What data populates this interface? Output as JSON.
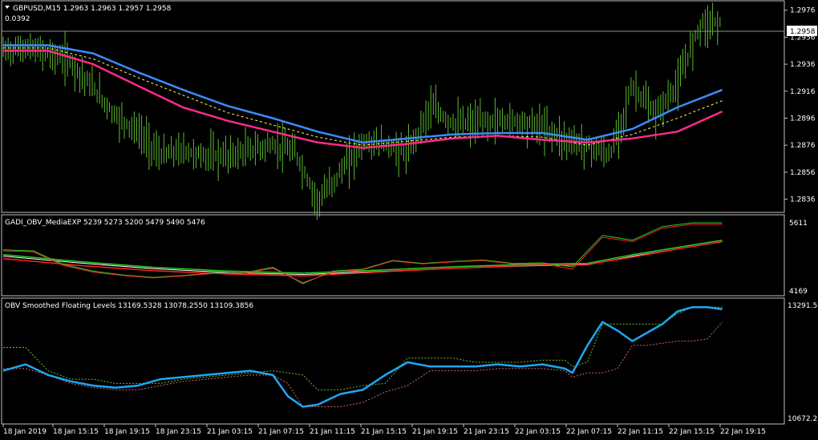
{
  "colors": {
    "background": "#000000",
    "foreground": "#ffffff",
    "grid": "#c0c0c0",
    "bars": "#5cb82e",
    "ma_fast": "#ff2a8a",
    "ma_slow": "#3b8cff",
    "ma_mid": "#ffff66",
    "obv_line": "#1ea7f0",
    "gadi_green": "#23d023",
    "gadi_red": "#ff2222",
    "gadi_white": "#ffffff",
    "level_green": "#6bbd3a",
    "level_red": "#d06a6a"
  },
  "main_panel": {
    "title": "GBPUSD,M15  1.2963 1.2963 1.2957 1.2958",
    "sub_label": "0.0392",
    "current_price_label": "1.2958",
    "y_ticks": [
      "1.2976",
      "1.2956",
      "1.2936",
      "1.2916",
      "1.2896",
      "1.2876",
      "1.2856",
      "1.2836"
    ]
  },
  "gadi_panel": {
    "title": "GADI_OBV_MediaEXP 5239 5273 5200 5479 5490 5476",
    "y_ticks": [
      "5611",
      "4169"
    ]
  },
  "obv_panel": {
    "title": "OBV Smoothed Floating Levels 13169.5328 13078.2550 13109.3856",
    "y_ticks": [
      "13291.50",
      "10672.25"
    ]
  },
  "x_axis": {
    "labels": [
      "18 Jan 2019",
      "18 Jan 15:15",
      "18 Jan 19:15",
      "18 Jan 23:15",
      "21 Jan 03:15",
      "21 Jan 07:15",
      "21 Jan 11:15",
      "21 Jan 15:15",
      "21 Jan 19:15",
      "21 Jan 23:15",
      "22 Jan 03:15",
      "22 Jan 07:15",
      "22 Jan 11:15",
      "22 Jan 15:15",
      "22 Jan 19:15"
    ]
  },
  "chart_data": [
    {
      "type": "line",
      "panel": "main",
      "title": "GBPUSD,M15  1.2963 1.2963 1.2957 1.2958",
      "ylim": [
        1.2828,
        1.298
      ],
      "x_range": [
        0,
        100
      ],
      "price_bars": {
        "x": [
          0,
          3,
          6,
          9,
          12,
          15,
          18,
          21,
          24,
          27,
          30,
          33,
          36,
          39,
          42,
          45,
          48,
          51,
          54,
          57,
          60,
          63,
          66,
          69,
          72,
          75,
          78,
          81,
          84,
          87,
          90,
          93,
          96
        ],
        "close": [
          1.2946,
          1.2948,
          1.2944,
          1.2938,
          1.2918,
          1.2898,
          1.2886,
          1.2868,
          1.2872,
          1.2868,
          1.2868,
          1.2872,
          1.2876,
          1.287,
          1.2834,
          1.2856,
          1.2878,
          1.2876,
          1.287,
          1.2904,
          1.2892,
          1.2892,
          1.2894,
          1.2894,
          1.289,
          1.288,
          1.2876,
          1.2868,
          1.292,
          1.2898,
          1.292,
          1.2966,
          1.2968
        ]
      },
      "series": [
        {
          "x": [
            0,
            6,
            12,
            18,
            24,
            30,
            36,
            42,
            48,
            54,
            60,
            66,
            72,
            78,
            84,
            90,
            96
          ],
          "values": [
            1.295,
            1.295,
            1.2944,
            1.293,
            1.2917,
            1.2905,
            1.2896,
            1.2886,
            1.2878,
            1.2881,
            1.2884,
            1.2885,
            1.2885,
            1.288,
            1.2888,
            1.2904,
            1.2917
          ]
        },
        {
          "x": [
            0,
            6,
            12,
            18,
            24,
            30,
            36,
            42,
            48,
            54,
            60,
            66,
            72,
            78,
            84,
            90,
            96
          ],
          "values": [
            1.2948,
            1.2948,
            1.294,
            1.2926,
            1.2913,
            1.29,
            1.2891,
            1.2882,
            1.2876,
            1.2879,
            1.2882,
            1.2883,
            1.2882,
            1.2876,
            1.2884,
            1.2896,
            1.2909
          ]
        },
        {
          "x": [
            0,
            6,
            12,
            18,
            24,
            30,
            36,
            42,
            48,
            54,
            60,
            66,
            72,
            78,
            84,
            90,
            96
          ],
          "values": [
            1.2946,
            1.2946,
            1.2936,
            1.292,
            1.2904,
            1.2894,
            1.2886,
            1.2878,
            1.2874,
            1.2877,
            1.2881,
            1.2883,
            1.288,
            1.2878,
            1.2881,
            1.2886,
            1.2901
          ]
        }
      ]
    },
    {
      "type": "line",
      "panel": "gadi",
      "title": "GADI_OBV_MediaEXP 5239 5273 5200 5479 5490 5476",
      "ylim": [
        4100,
        5660
      ],
      "x_range": [
        0,
        100
      ],
      "series": [
        {
          "x": [
            0,
            4,
            8,
            12,
            16,
            20,
            24,
            28,
            32,
            36,
            40,
            44,
            48,
            52,
            56,
            60,
            64,
            68,
            72,
            76,
            80,
            84,
            88,
            92,
            96
          ],
          "values": [
            5000,
            4980,
            4700,
            4560,
            4480,
            4430,
            4470,
            4520,
            4520,
            4640,
            4300,
            4560,
            4600,
            4780,
            4720,
            4760,
            4790,
            4720,
            4730,
            4650,
            5300,
            5200,
            5480,
            5560,
            5560
          ]
        },
        {
          "x": [
            0,
            4,
            8,
            12,
            16,
            20,
            24,
            28,
            32,
            36,
            40,
            44,
            48,
            52,
            56,
            60,
            64,
            68,
            72,
            76,
            80,
            84,
            88,
            92,
            96
          ],
          "values": [
            4980,
            4960,
            4680,
            4540,
            4470,
            4420,
            4460,
            4510,
            4510,
            4620,
            4320,
            4540,
            4590,
            4770,
            4710,
            4750,
            4780,
            4710,
            4720,
            4600,
            5260,
            5170,
            5450,
            5530,
            5530
          ]
        },
        {
          "x": [
            0,
            10,
            20,
            30,
            40,
            50,
            60,
            70,
            78,
            84,
            90,
            96
          ],
          "values": [
            4900,
            4760,
            4640,
            4560,
            4520,
            4580,
            4650,
            4700,
            4720,
            4900,
            5050,
            5200
          ]
        },
        {
          "x": [
            0,
            10,
            20,
            30,
            40,
            50,
            60,
            70,
            78,
            84,
            90,
            96
          ],
          "values": [
            4820,
            4680,
            4570,
            4500,
            4460,
            4540,
            4620,
            4680,
            4700,
            4850,
            5020,
            5170
          ]
        }
      ]
    },
    {
      "type": "line",
      "panel": "obv",
      "title": "OBV Smoothed Floating Levels 13169.5328 13078.2550 13109.3856",
      "ylim": [
        10600,
        13400
      ],
      "x_range": [
        0,
        100
      ],
      "series": [
        {
          "x": [
            0,
            3,
            6,
            9,
            12,
            15,
            18,
            21,
            24,
            27,
            30,
            33,
            36,
            38,
            40,
            42,
            45,
            48,
            51,
            54,
            57,
            60,
            63,
            66,
            69,
            72,
            75,
            76,
            78,
            80,
            82,
            84,
            86,
            88,
            90,
            92,
            94,
            96
          ],
          "values": [
            11800,
            11950,
            11700,
            11550,
            11450,
            11400,
            11450,
            11600,
            11650,
            11700,
            11750,
            11800,
            11700,
            11200,
            10950,
            11000,
            11250,
            11350,
            11700,
            12000,
            11900,
            11900,
            11900,
            11950,
            11900,
            11950,
            11850,
            11750,
            12400,
            12950,
            12750,
            12500,
            12700,
            12900,
            13200,
            13300,
            13300,
            13250
          ]
        },
        {
          "x": [
            0,
            3,
            6,
            9,
            12,
            15,
            18,
            21,
            24,
            27,
            30,
            33,
            36,
            38,
            40,
            42,
            45,
            48,
            51,
            54,
            57,
            60,
            63,
            66,
            69,
            72,
            75,
            76,
            78,
            80,
            82,
            84,
            86,
            88,
            90,
            92,
            94,
            96
          ],
          "values": [
            12350,
            12350,
            11800,
            11600,
            11600,
            11500,
            11500,
            11500,
            11600,
            11650,
            11700,
            11750,
            11800,
            11750,
            11700,
            11350,
            11350,
            11450,
            11500,
            12100,
            12100,
            12100,
            12000,
            12000,
            12000,
            12050,
            12050,
            11900,
            12000,
            12900,
            12900,
            12900,
            12900,
            12900,
            13150,
            13300,
            13300,
            13300
          ]
        },
        {
          "x": [
            0,
            3,
            6,
            9,
            12,
            15,
            18,
            21,
            24,
            27,
            30,
            33,
            36,
            38,
            40,
            42,
            45,
            48,
            51,
            54,
            57,
            60,
            63,
            66,
            69,
            72,
            75,
            76,
            78,
            80,
            82,
            84,
            86,
            88,
            90,
            92,
            94,
            96
          ],
          "values": [
            11850,
            11850,
            11700,
            11500,
            11400,
            11350,
            11350,
            11450,
            11550,
            11600,
            11650,
            11700,
            11700,
            11500,
            10950,
            10950,
            10950,
            11050,
            11300,
            11450,
            11800,
            11800,
            11800,
            11850,
            11850,
            11850,
            11800,
            11650,
            11750,
            11750,
            11850,
            12400,
            12400,
            12450,
            12500,
            12500,
            12550,
            12950
          ]
        }
      ]
    }
  ]
}
